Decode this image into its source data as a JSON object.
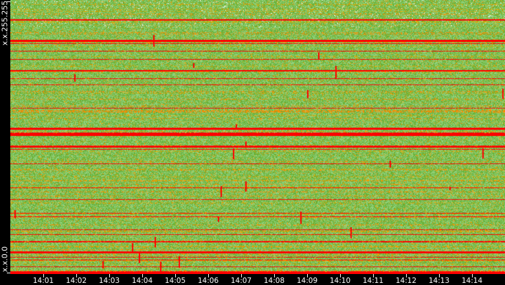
{
  "chart_data": {
    "type": "heatmap",
    "title": "",
    "xlabel": "",
    "ylabel": "",
    "x_tick_labels": [
      "14:01",
      "14:02",
      "14:03",
      "14:04",
      "14:05",
      "14:06",
      "14:07",
      "14:08",
      "14:09",
      "14:10",
      "14:11",
      "14:12",
      "14:13",
      "14:14"
    ],
    "y_tick_labels": [
      "x.x.255.255",
      "x.x.0.0"
    ],
    "y_range": [
      "x.x.0.0",
      "x.x.255.255"
    ],
    "color_scale": [
      "#ffffff",
      "#8fcf7a",
      "#6cb33a",
      "#e0a800",
      "#ff8c00",
      "#ff0000"
    ],
    "background": "#000000"
  }
}
